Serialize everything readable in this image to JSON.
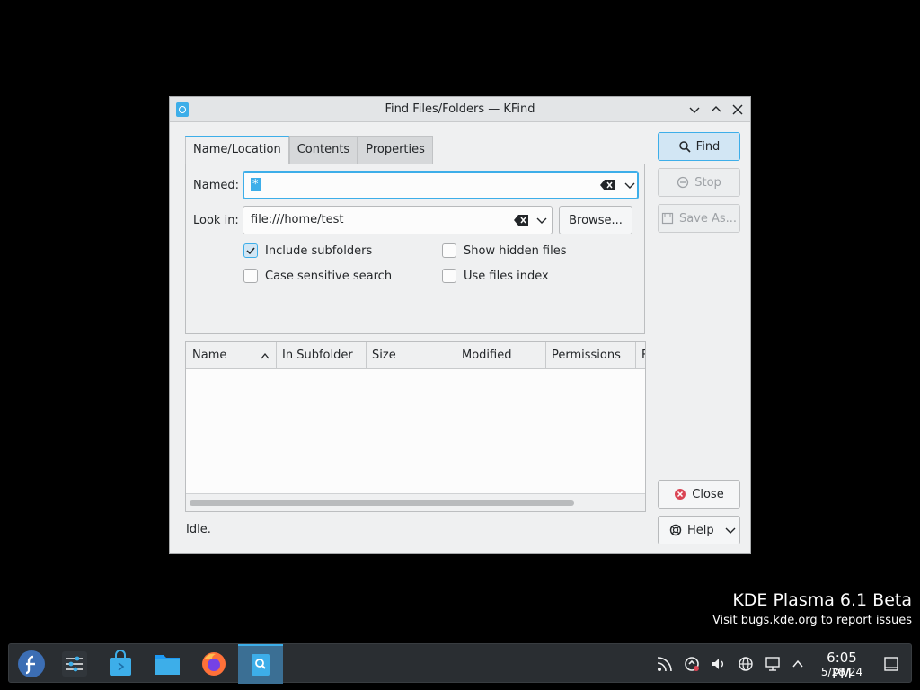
{
  "window": {
    "title": "Find Files/Folders — KFind"
  },
  "tabs": [
    {
      "label": "Name/Location"
    },
    {
      "label": "Contents"
    },
    {
      "label": "Properties"
    }
  ],
  "form": {
    "named_label": "Named:",
    "named_value": "*",
    "lookin_label": "Look in:",
    "lookin_value": "file:///home/test",
    "browse_label": "Browse...",
    "include_subfolders": {
      "label": "Include subfolders",
      "checked": true
    },
    "case_sensitive": {
      "label": "Case sensitive search",
      "checked": false
    },
    "show_hidden": {
      "label": "Show hidden files",
      "checked": false
    },
    "use_index": {
      "label": "Use files index",
      "checked": false
    }
  },
  "actions": {
    "find": "Find",
    "stop": "Stop",
    "save_as": "Save As...",
    "close": "Close",
    "help": "Help"
  },
  "results": {
    "columns": [
      "Name",
      "In Subfolder",
      "Size",
      "Modified",
      "Permissions",
      "F"
    ]
  },
  "status": "Idle.",
  "desktop": {
    "title": "KDE Plasma 6.1 Beta",
    "subtitle": "Visit bugs.kde.org to report issues"
  },
  "taskbar": {
    "time": "6:05 PM",
    "date": "5/28/24"
  },
  "colors": {
    "accent": "#3daee9",
    "window_bg": "#eff0f1",
    "taskbar_bg": "#2a2e32"
  }
}
